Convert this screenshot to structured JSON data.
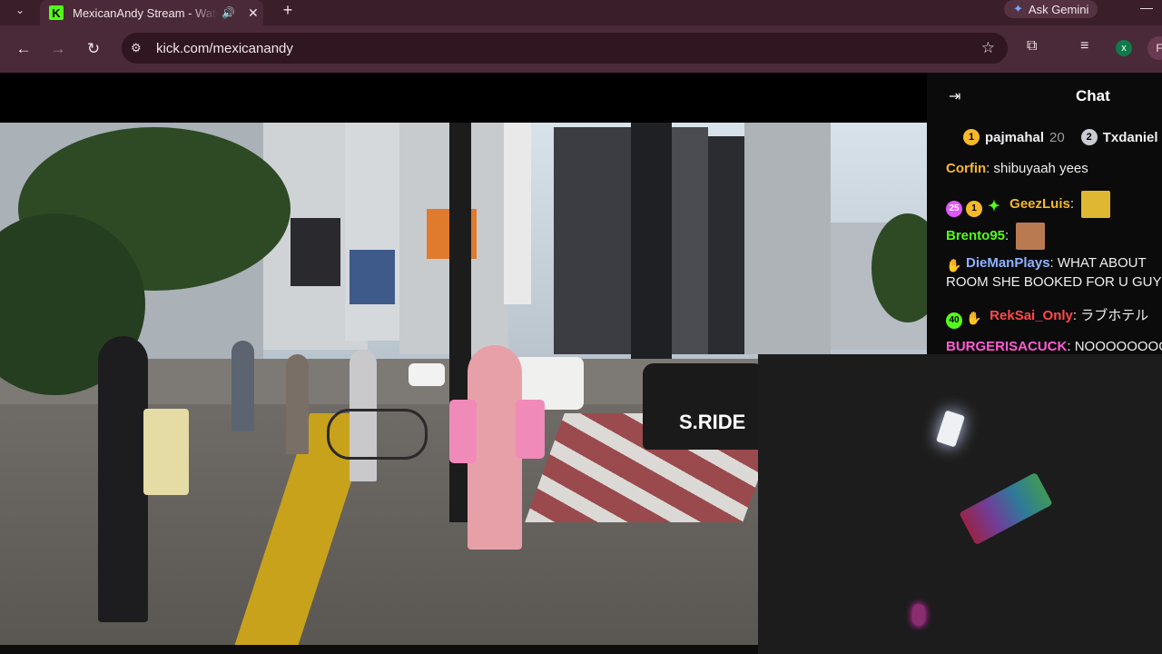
{
  "browser": {
    "tab_title": "MexicanAndy Stream - Watch Live on Kick",
    "favicon_letter": "K",
    "new_tab_symbol": "+",
    "gemini_label": "Ask Gemini",
    "url": "kick.com/mexicanandy",
    "profile_initial": "x",
    "profile2_initial": "F"
  },
  "chat": {
    "title": "Chat",
    "top_gifters": [
      {
        "rank": "1",
        "name": "pajmahal",
        "count": "20"
      },
      {
        "rank": "2",
        "name": "Txdaniel",
        "count": ""
      }
    ],
    "messages": [
      {
        "user": "Corfin",
        "color": "#f7b928",
        "badges": [],
        "text": "shibuyaah yees",
        "emote": ""
      },
      {
        "user": "GeezLuis",
        "color": "#f7b928",
        "badges": [
          "25",
          "1",
          "✦"
        ],
        "text": "",
        "emote": "laugh-emote"
      },
      {
        "user": "Brento95",
        "color": "#53fc18",
        "badges": [],
        "text": "",
        "emote": "face-emote"
      },
      {
        "user": "DieManPlays",
        "color": "#8fb3ff",
        "badges": [
          "✋"
        ],
        "text": "WHAT ABOUT",
        "text2": "ROOM SHE BOOKED FOR U GUY",
        "emote": ""
      },
      {
        "user": "RekSai_Only",
        "color": "#ff4a4a",
        "badges": [
          "40",
          "✋"
        ],
        "text": "ラブホテル",
        "emote": ""
      },
      {
        "user": "BURGERISACUCK",
        "color": "#ff5cd1",
        "badges": [],
        "text": "NOOOOOOOO",
        "emote": ""
      }
    ]
  },
  "stream": {
    "van_text": "S.RIDE"
  },
  "colors": {
    "kick_green": "#53fc18",
    "chrome_bg": "#4a2a38"
  }
}
